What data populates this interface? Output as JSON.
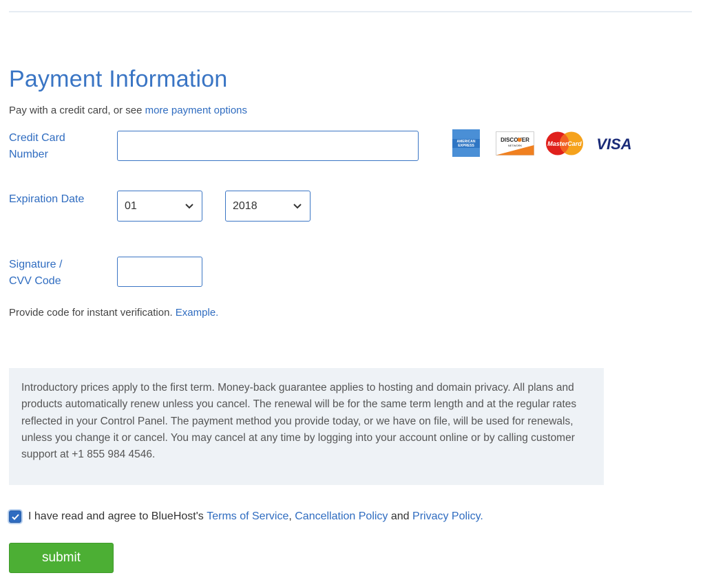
{
  "header": {
    "title": "Payment Information"
  },
  "subtitle": {
    "text": "Pay with a credit card, or see ",
    "link": "more payment options"
  },
  "card_number": {
    "label_line1": "Credit Card",
    "label_line2": "Number",
    "value": "",
    "placeholder": ""
  },
  "card_brands": {
    "amex": "AMERICAN EXPRESS",
    "discover": "DISCOVER",
    "discover_sub": "NETWORK",
    "mastercard": "MasterCard",
    "visa": "VISA"
  },
  "expiration": {
    "label": "Expiration Date",
    "month": "01",
    "year": "2018"
  },
  "cvv": {
    "label_line1": "Signature /",
    "label_line2": "CVV Code",
    "value": ""
  },
  "hint": {
    "text": "Provide code for instant verification. ",
    "link": "Example."
  },
  "notice": {
    "text": "Introductory prices apply to the first term. Money-back guarantee applies to hosting and domain privacy. All plans and products automatically renew unless you cancel. The renewal will be for the same term length and at the regular rates reflected in your Control Panel. The payment method you provide today, or we have on file, will be used for renewals, unless you change it or cancel. You may cancel at any time by logging into your account online or by calling customer support at +1 855 984 4546."
  },
  "agreement": {
    "checked": true,
    "prefix": "I have read and agree to BlueHost's ",
    "terms": "Terms of Service",
    "comma": ", ",
    "cancellation": "Cancellation Policy",
    "and": " and ",
    "privacy": "Privacy Policy."
  },
  "submit": {
    "label": "submit"
  },
  "colors": {
    "accent": "#2f6cc0",
    "submit": "#4caf34",
    "notice_bg": "#eef2f6"
  }
}
